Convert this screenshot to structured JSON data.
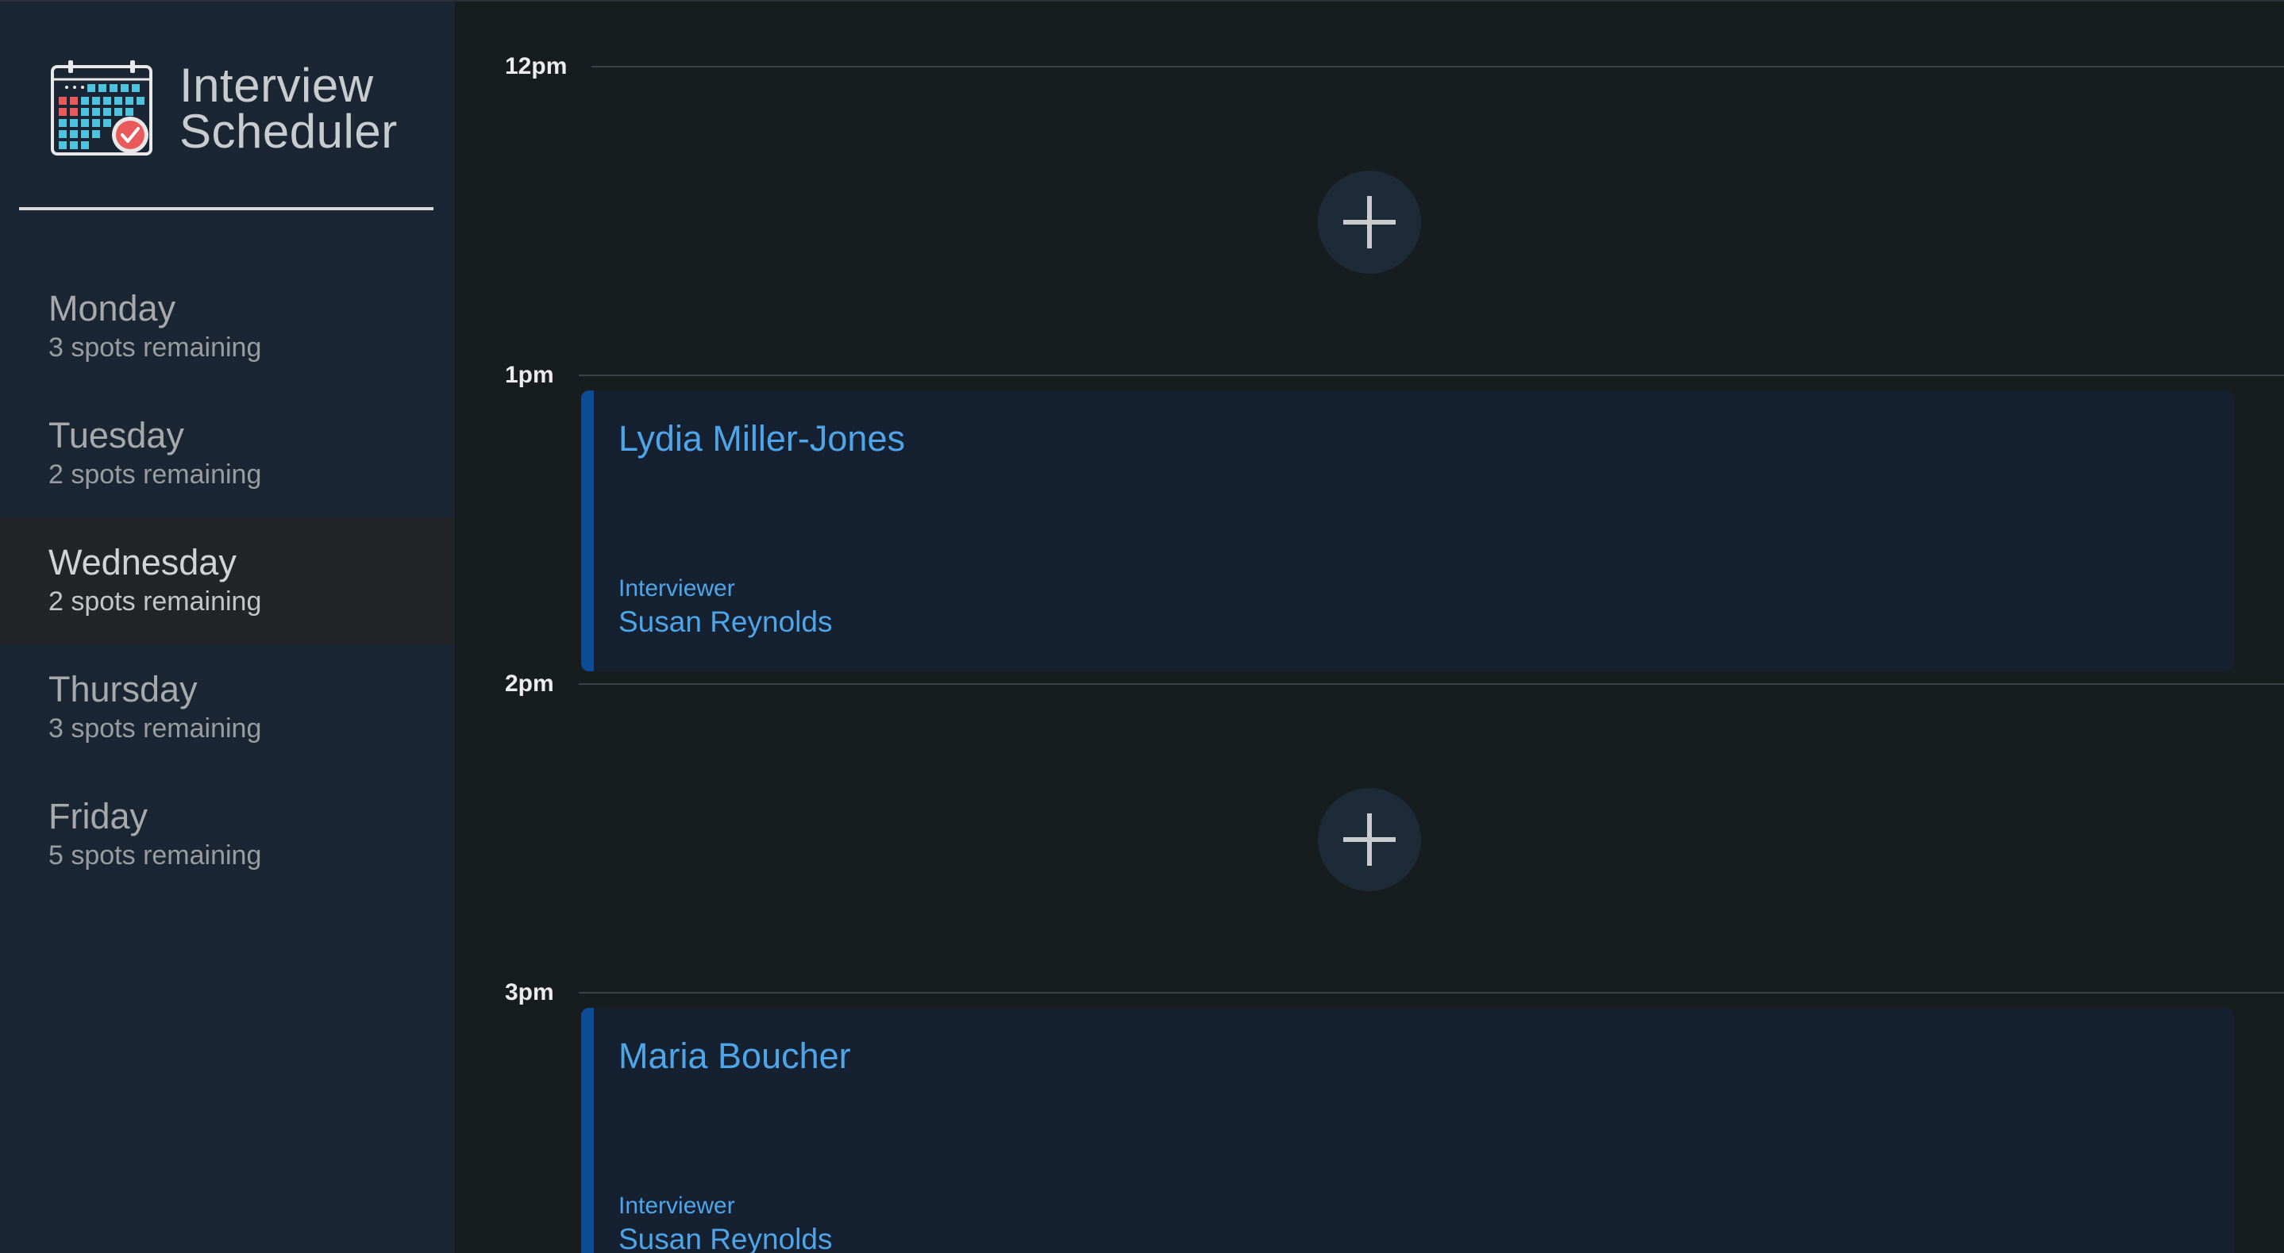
{
  "app": {
    "title_line1": "Interview",
    "title_line2": "Scheduler"
  },
  "sidebar": {
    "days": [
      {
        "name": "Monday",
        "spots": "3 spots remaining",
        "selected": false
      },
      {
        "name": "Tuesday",
        "spots": "2 spots remaining",
        "selected": false
      },
      {
        "name": "Wednesday",
        "spots": "2 spots remaining",
        "selected": true
      },
      {
        "name": "Thursday",
        "spots": "3 spots remaining",
        "selected": false
      },
      {
        "name": "Friday",
        "spots": "5 spots remaining",
        "selected": false
      }
    ]
  },
  "schedule": {
    "slots": [
      {
        "time": "12pm",
        "status": "empty"
      },
      {
        "time": "1pm",
        "status": "booked",
        "student": "Lydia Miller-Jones",
        "interviewer_label": "Interviewer",
        "interviewer": "Susan Reynolds"
      },
      {
        "time": "2pm",
        "status": "empty"
      },
      {
        "time": "3pm",
        "status": "booked",
        "student": "Maria Boucher",
        "interviewer_label": "Interviewer",
        "interviewer": "Susan Reynolds"
      }
    ]
  },
  "colors": {
    "sidebar_bg": "#1a2634",
    "main_bg": "#171c1e",
    "accent": "#4ea5e8",
    "appointment_border": "#0d4b96"
  },
  "icons": {
    "logo": "calendar-check-icon",
    "add": "plus-icon"
  }
}
